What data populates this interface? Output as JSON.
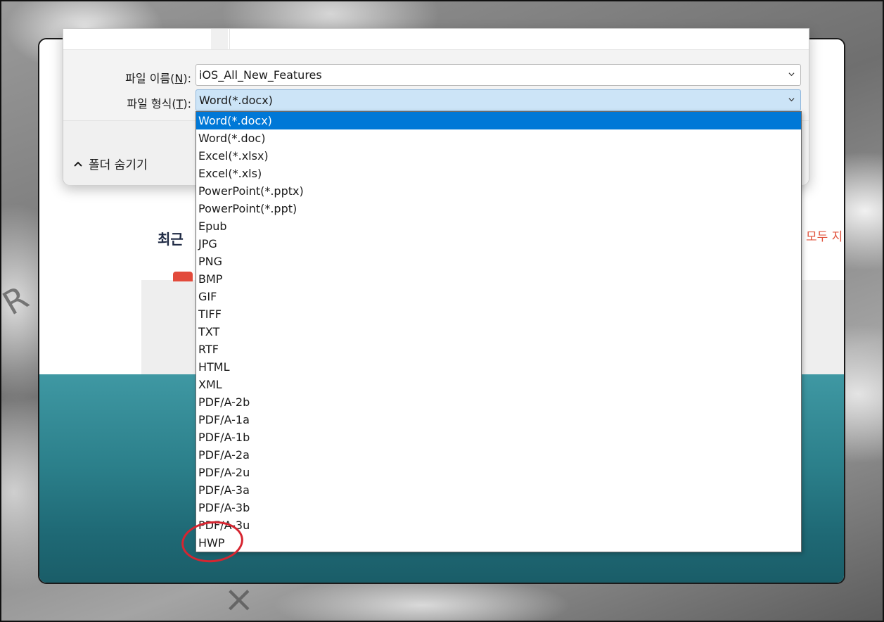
{
  "dialog": {
    "filename_label": "파일 이름(",
    "filename_key": "N",
    "filename_suffix": "):",
    "filename_value": "iOS_All_New_Features",
    "filetype_label": "파일 형식(",
    "filetype_key": "T",
    "filetype_suffix": "):",
    "filetype_value": "Word(*.docx)",
    "hide_folders": "폴더 숨기기"
  },
  "app": {
    "recent_title": "최근",
    "delete_all": "모두 지"
  },
  "dropdown": {
    "selected_index": 0,
    "options": [
      "Word(*.docx)",
      "Word(*.doc)",
      "Excel(*.xlsx)",
      "Excel(*.xls)",
      "PowerPoint(*.pptx)",
      "PowerPoint(*.ppt)",
      "Epub",
      "JPG",
      "PNG",
      "BMP",
      "GIF",
      "TIFF",
      "TXT",
      "RTF",
      "HTML",
      "XML",
      "PDF/A-2b",
      "PDF/A-1a",
      "PDF/A-1b",
      "PDF/A-2a",
      "PDF/A-2u",
      "PDF/A-3a",
      "PDF/A-3b",
      "PDF/A-3u",
      "HWP"
    ]
  },
  "colors": {
    "selection": "#0078d7",
    "active_combo": "#cce4f7",
    "annotation": "#d62530",
    "teal": "#2b7f8a"
  }
}
